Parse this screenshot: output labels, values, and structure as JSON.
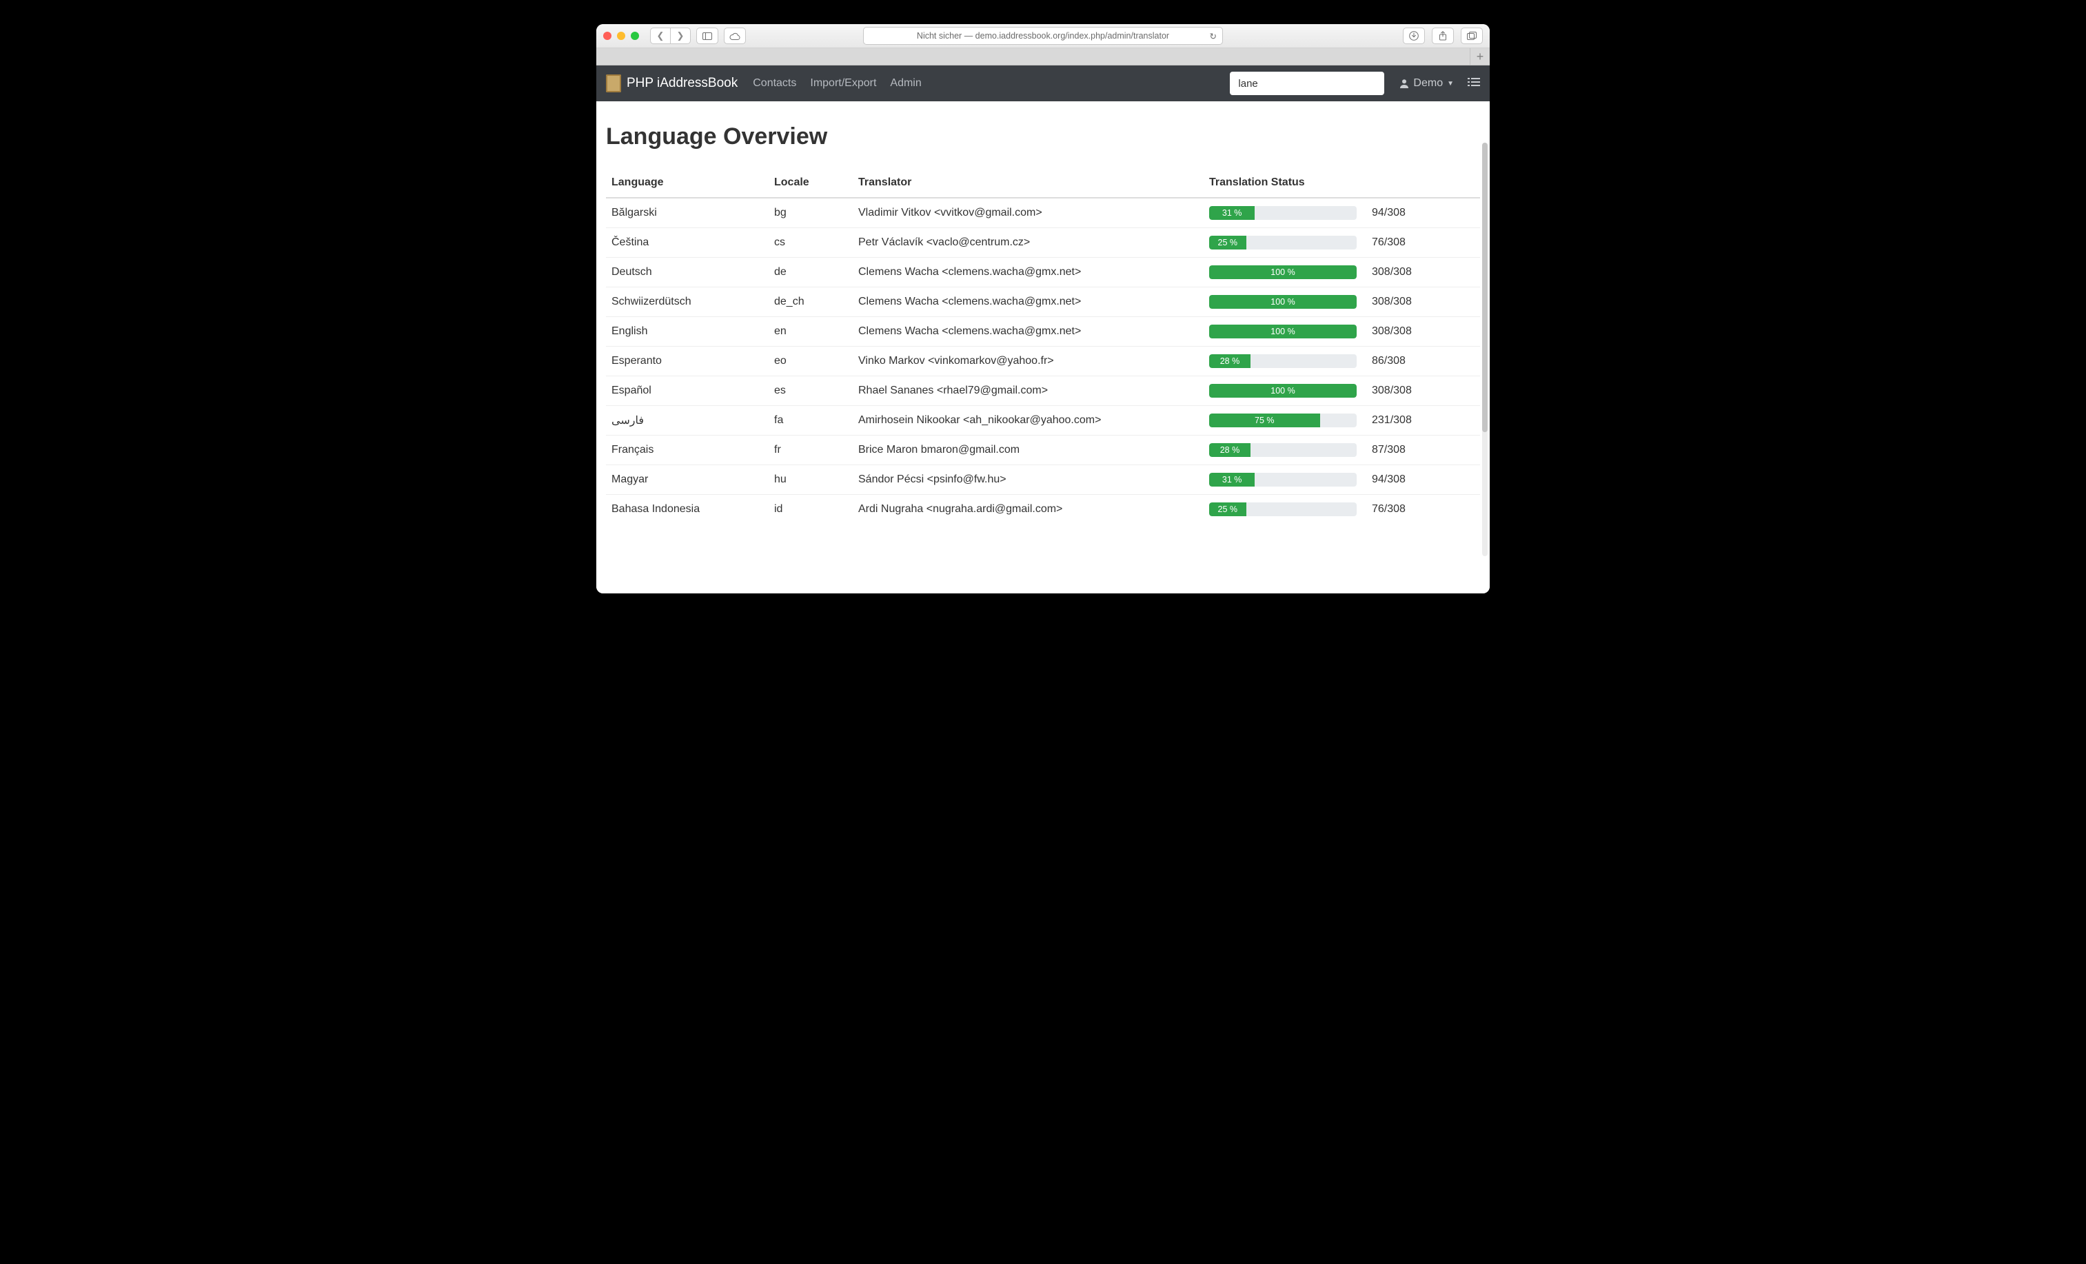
{
  "browser": {
    "url": "Nicht sicher — demo.iaddressbook.org/index.php/admin/translator"
  },
  "navbar": {
    "brand": "PHP iAddressBook",
    "links": [
      "Contacts",
      "Import/Export",
      "Admin"
    ],
    "search_value": "lane",
    "user": "Demo"
  },
  "page": {
    "title": "Language Overview",
    "columns": [
      "Language",
      "Locale",
      "Translator",
      "Translation Status"
    ]
  },
  "rows": [
    {
      "language": "Bălgarski",
      "locale": "bg",
      "translator": "Vladimir Vitkov <vvitkov@gmail.com>",
      "percent": 31,
      "done": 94,
      "total": 308
    },
    {
      "language": "Čeština",
      "locale": "cs",
      "translator": "Petr Václavík <vaclo@centrum.cz>",
      "percent": 25,
      "done": 76,
      "total": 308
    },
    {
      "language": "Deutsch",
      "locale": "de",
      "translator": "Clemens Wacha <clemens.wacha@gmx.net>",
      "percent": 100,
      "done": 308,
      "total": 308
    },
    {
      "language": "Schwiizerdütsch",
      "locale": "de_ch",
      "translator": "Clemens Wacha <clemens.wacha@gmx.net>",
      "percent": 100,
      "done": 308,
      "total": 308
    },
    {
      "language": "English",
      "locale": "en",
      "translator": "Clemens Wacha <clemens.wacha@gmx.net>",
      "percent": 100,
      "done": 308,
      "total": 308
    },
    {
      "language": "Esperanto",
      "locale": "eo",
      "translator": "Vinko Markov <vinkomarkov@yahoo.fr>",
      "percent": 28,
      "done": 86,
      "total": 308
    },
    {
      "language": "Español",
      "locale": "es",
      "translator": "Rhael Sananes <rhael79@gmail.com>",
      "percent": 100,
      "done": 308,
      "total": 308
    },
    {
      "language": "فارسی",
      "locale": "fa",
      "translator": "Amirhosein Nikookar <ah_nikookar@yahoo.com>",
      "percent": 75,
      "done": 231,
      "total": 308
    },
    {
      "language": "Français",
      "locale": "fr",
      "translator": "Brice Maron bmaron@gmail.com",
      "percent": 28,
      "done": 87,
      "total": 308
    },
    {
      "language": "Magyar",
      "locale": "hu",
      "translator": "Sándor Pécsi <psinfo@fw.hu>",
      "percent": 31,
      "done": 94,
      "total": 308
    },
    {
      "language": "Bahasa Indonesia",
      "locale": "id",
      "translator": "Ardi Nugraha <nugraha.ardi@gmail.com>",
      "percent": 25,
      "done": 76,
      "total": 308
    }
  ]
}
